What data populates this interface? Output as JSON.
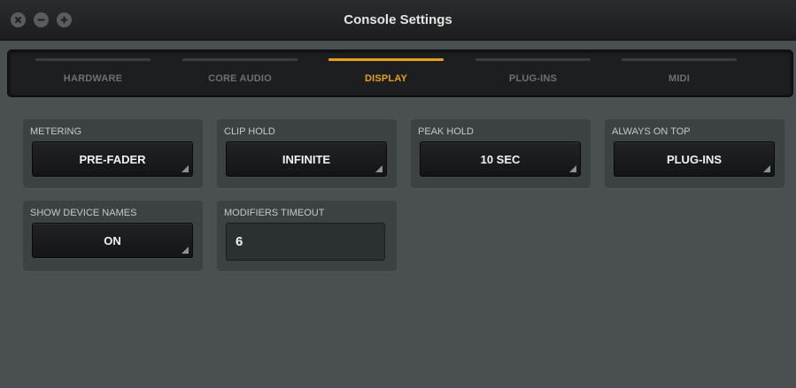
{
  "window": {
    "title": "Console Settings"
  },
  "tabs": [
    {
      "label": "HARDWARE",
      "active": false
    },
    {
      "label": "CORE AUDIO",
      "active": false
    },
    {
      "label": "DISPLAY",
      "active": true
    },
    {
      "label": "PLUG-INS",
      "active": false
    },
    {
      "label": "MIDI",
      "active": false
    }
  ],
  "settings": {
    "metering": {
      "label": "METERING",
      "value": "PRE-FADER"
    },
    "clip_hold": {
      "label": "CLIP HOLD",
      "value": "INFINITE"
    },
    "peak_hold": {
      "label": "PEAK HOLD",
      "value": "10 SEC"
    },
    "always_on_top": {
      "label": "ALWAYS ON TOP",
      "value": "PLUG-INS"
    },
    "show_device_names": {
      "label": "SHOW DEVICE NAMES",
      "value": "ON"
    },
    "modifiers_timeout": {
      "label": "MODIFIERS TIMEOUT",
      "value": "6"
    }
  },
  "colors": {
    "accent": "#e8a020",
    "background": "#4a5052",
    "panel": "#3c4244"
  },
  "icons": {
    "close": "close-icon",
    "minimize": "minimize-icon",
    "zoom": "zoom-icon"
  }
}
